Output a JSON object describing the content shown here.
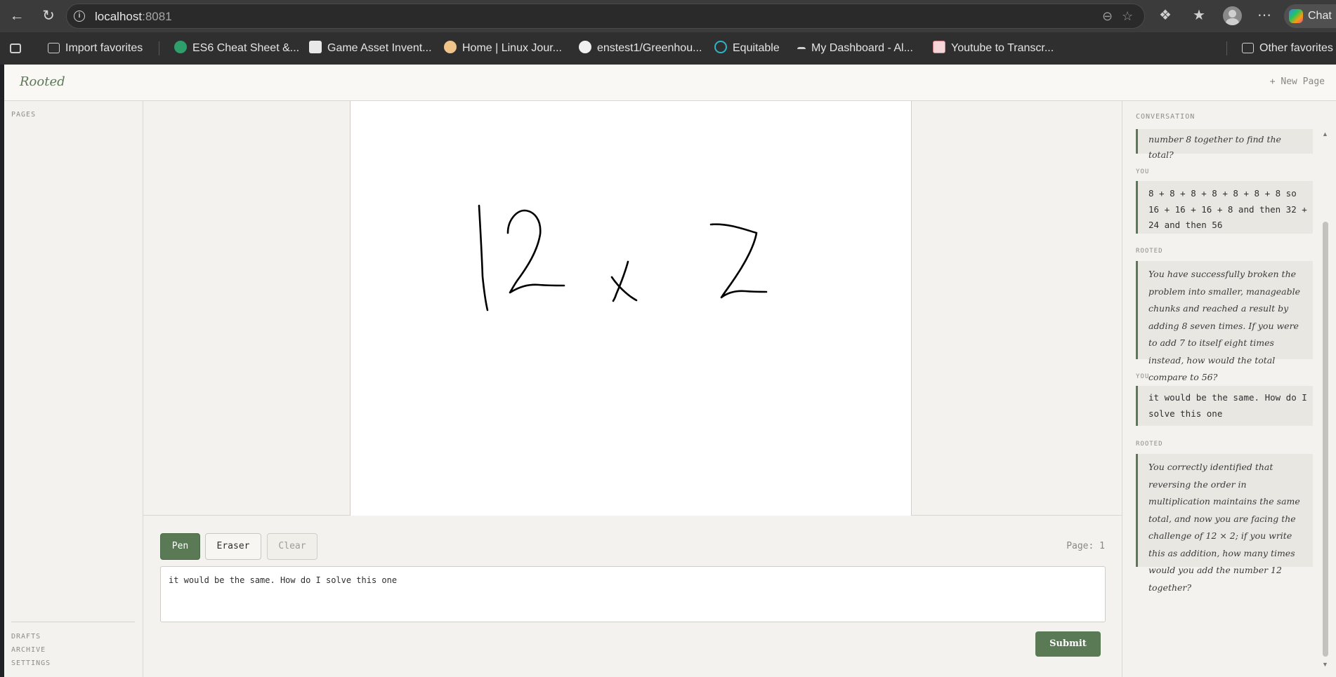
{
  "browser": {
    "url_host": "localhost",
    "url_port": ":8081",
    "copilot_label": "Chat"
  },
  "favorites": [
    {
      "label": "Import favorites",
      "icon": "import-icon"
    },
    {
      "label": "ES6 Cheat Sheet &...",
      "icon": "es6-favicon"
    },
    {
      "label": "Game Asset Invent...",
      "icon": "trello-favicon"
    },
    {
      "label": "Home | Linux Jour...",
      "icon": "linux-journey-favicon"
    },
    {
      "label": "enstest1/Greenhou...",
      "icon": "github-favicon"
    },
    {
      "label": "Equitable",
      "icon": "equitable-favicon"
    },
    {
      "label": "My Dashboard - Al...",
      "icon": "dashboard-favicon"
    },
    {
      "label": "Youtube to Transcr...",
      "icon": "youtube-transcript-favicon"
    },
    {
      "label": "Other favorites",
      "icon": "folder-icon"
    }
  ],
  "app": {
    "brand": "Rooted",
    "new_page": "+ New Page"
  },
  "sidebar": {
    "pages_label": "PAGES",
    "bottom_links": [
      "DRAFTS",
      "ARCHIVE",
      "SETTINGS"
    ]
  },
  "toolbar": {
    "pen": "Pen",
    "eraser": "Eraser",
    "clear": "Clear",
    "page_indicator": "Page: 1",
    "submit": "Submit"
  },
  "answer_text": "it would be the same. How do I solve this one",
  "conversation": {
    "label": "CONVERSATION",
    "messages": [
      {
        "role": "",
        "text": "number 8 together to find the total?"
      },
      {
        "role": "YOU",
        "text": "8 + 8 + 8 + 8 + 8 + 8 + 8 so 16 + 16 + 16 + 8 and then 32 + 24 and then 56"
      },
      {
        "role": "ROOTED",
        "text": "You have successfully broken the problem into smaller, manageable chunks and reached a result by adding 8 seven times. If you were to add 7 to itself eight times instead, how would the total compare to 56?"
      },
      {
        "role": "YOU",
        "text": "it would be the same. How do I solve this one"
      },
      {
        "role": "ROOTED",
        "text": "You correctly identified that reversing the order in multiplication maintains the same total, and now you are facing the challenge of 12 × 2; if you write this as addition, how many times would you add the number 12 together?"
      }
    ]
  }
}
